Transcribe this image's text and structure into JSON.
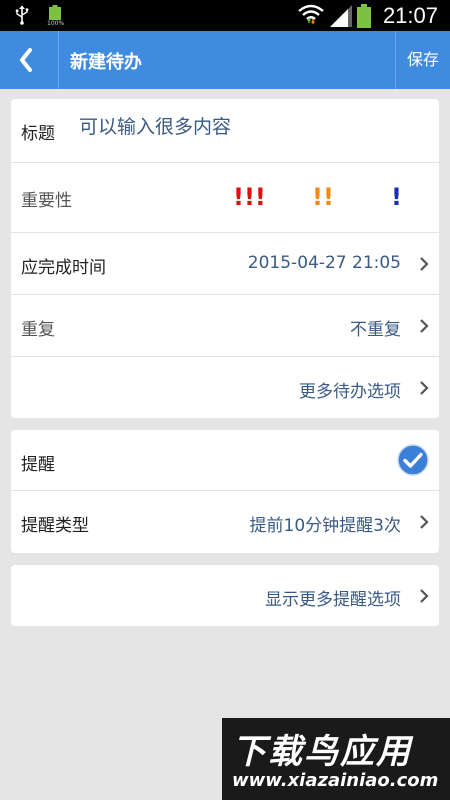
{
  "status_bar": {
    "time": "21:07",
    "battery_small_text": "100%"
  },
  "header": {
    "title": "新建待办",
    "save_label": "保存"
  },
  "form": {
    "title_label": "标题",
    "title_placeholder": "可以输入很多内容",
    "importance_label": "重要性",
    "importance_options": [
      {
        "text": "!!!",
        "color": "#e01010"
      },
      {
        "text": "!!",
        "color": "#f08a10"
      },
      {
        "text": "!",
        "color": "#1a2fb8"
      }
    ],
    "due_label": "应完成时间",
    "due_value": "2015-04-27 21:05",
    "repeat_label": "重复",
    "repeat_value": "不重复",
    "more_todo_options": "更多待办选项"
  },
  "reminder": {
    "label": "提醒",
    "enabled": true,
    "type_label": "提醒类型",
    "type_value": "提前10分钟提醒3次"
  },
  "more_reminder_options": "显示更多提醒选项",
  "watermark": {
    "top": "下载鸟应用",
    "bottom": "www.xiazainiao.com"
  },
  "colors": {
    "header_bg": "#3e8be0",
    "value_text": "#3a5a86",
    "check_blue": "#3a7fd8"
  }
}
